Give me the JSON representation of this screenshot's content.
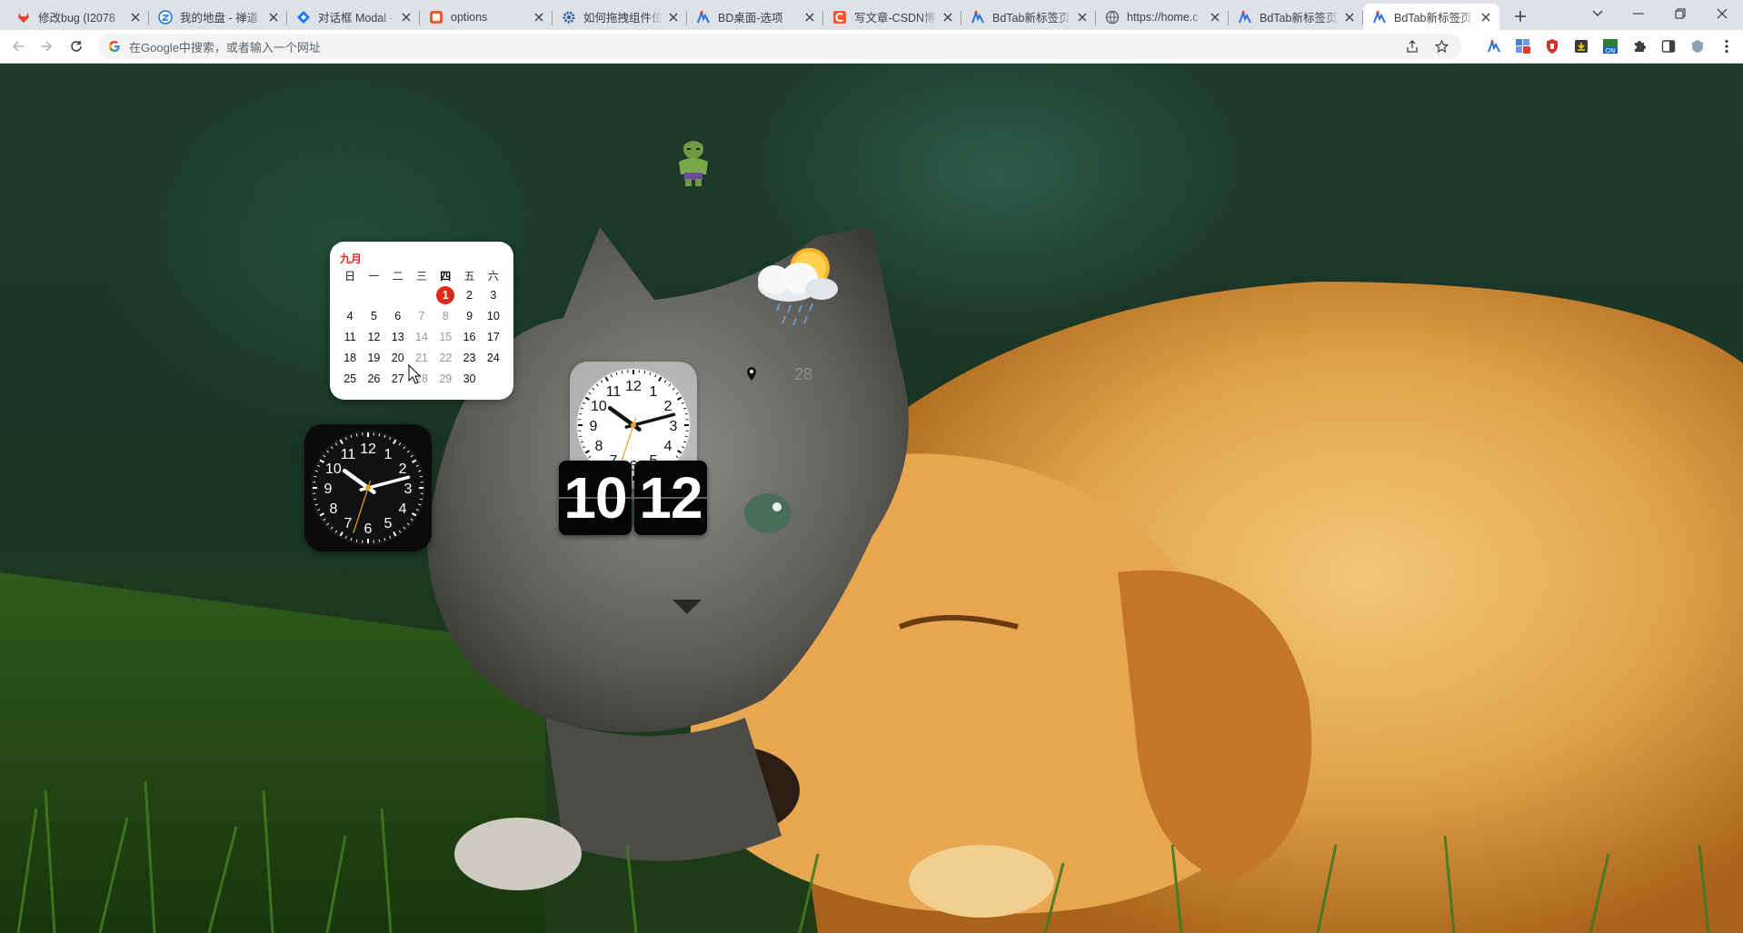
{
  "tabs": [
    {
      "title": "修改bug (I2078",
      "favicon": "gitlab-icon"
    },
    {
      "title": "我的地盘 - 禅道",
      "favicon": "zentao-icon"
    },
    {
      "title": "对话框 Modal - A",
      "favicon": "antd-icon"
    },
    {
      "title": "options",
      "favicon": "options-icon"
    },
    {
      "title": "如何拖拽组件位",
      "favicon": "gear-icon"
    },
    {
      "title": "BD桌面-选项",
      "favicon": "bdtab-icon"
    },
    {
      "title": "写文章-CSDN博",
      "favicon": "csdn-icon"
    },
    {
      "title": "BdTab新标签页",
      "favicon": "bdtab-icon"
    },
    {
      "title": "https://home.c",
      "favicon": "globe-icon"
    },
    {
      "title": "BdTab新标签页",
      "favicon": "bdtab-icon"
    },
    {
      "title": "BdTab新标签页",
      "favicon": "bdtab-icon",
      "active": true
    }
  ],
  "omnibox": {
    "placeholder": "在Google中搜索，或者输入一个网址"
  },
  "calendar": {
    "month": "九月",
    "weekdays": [
      "日",
      "一",
      "二",
      "三",
      "四",
      "五",
      "六"
    ],
    "today_weekday_index": 4,
    "weeks": [
      [
        "",
        "",
        "",
        "",
        "1",
        "2",
        "3"
      ],
      [
        "4",
        "5",
        "6",
        "7",
        "8",
        "9",
        "10"
      ],
      [
        "11",
        "12",
        "13",
        "14",
        "15",
        "16",
        "17"
      ],
      [
        "18",
        "19",
        "20",
        "21",
        "22",
        "23",
        "24"
      ],
      [
        "25",
        "26",
        "27",
        "28",
        "29",
        "30",
        ""
      ]
    ],
    "today": "1",
    "greyed": [
      "7",
      "8",
      "14",
      "15",
      "21",
      "22",
      "28",
      "29"
    ]
  },
  "clock": {
    "hours": 10,
    "minutes": 12,
    "seconds": 33
  },
  "flipclock": {
    "hours": "10",
    "minutes": "12"
  },
  "weather": {
    "temperature": "28",
    "condition": "sun-cloud-rain-icon"
  },
  "colors": {
    "accent_red": "#e0281d",
    "tabstrip": "#dee1e6",
    "omnibox": "#f1f3f4"
  }
}
